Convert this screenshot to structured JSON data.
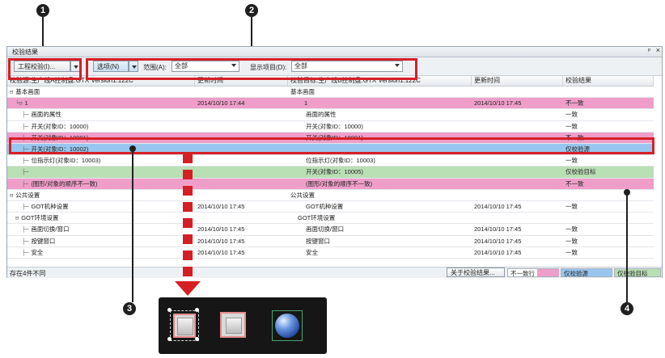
{
  "window": {
    "title": "校验结果",
    "pin_glyph": "ᵖ",
    "close_glyph": "×"
  },
  "toolbar": {
    "project_button": "工程校验(I)...",
    "options_button": "选项(N)",
    "range_label": "范围(A):",
    "range_value": "全部",
    "display_label": "显示项目(D):",
    "display_value": "全部"
  },
  "grid": {
    "columns": [
      "校验源:生产线A控制盘.GTX  Version1.122C",
      "更新时间",
      "校验目标:生产线B控制盘.GTX  Version1.122C",
      "更新时间",
      "校验结果"
    ],
    "rows": [
      {
        "type": "group",
        "src": "基本画面",
        "src_time": "",
        "tgt": "基本画面",
        "tgt_time": "",
        "result": "",
        "color": ""
      },
      {
        "type": "screen",
        "src": "1",
        "src_time": "2014/10/10 17:44",
        "tgt": "1",
        "tgt_time": "2014/10/10 17:45",
        "result": "不一致",
        "color": "pink"
      },
      {
        "type": "item",
        "src": "画面的属性",
        "src_time": "",
        "tgt": "画面的属性",
        "tgt_time": "",
        "result": "一致",
        "color": ""
      },
      {
        "type": "item",
        "src": "开关(对象ID：10000)",
        "src_time": "",
        "tgt": "开关(对象ID：10000)",
        "tgt_time": "",
        "result": "一致",
        "color": ""
      },
      {
        "type": "item",
        "src": "开关(对象ID：10001)",
        "src_time": "",
        "tgt": "开关(对象ID：10001)",
        "tgt_time": "",
        "result": "不一致",
        "color": "pink"
      },
      {
        "type": "item",
        "src": "开关(对象ID：10002)",
        "src_time": "",
        "tgt": "",
        "tgt_time": "",
        "result": "仅校验源",
        "color": "blue"
      },
      {
        "type": "item",
        "src": "位指示灯(对象ID：10003)",
        "src_time": "",
        "tgt": "位指示灯(对象ID：10003)",
        "tgt_time": "",
        "result": "一致",
        "color": ""
      },
      {
        "type": "item",
        "src": "",
        "src_time": "",
        "tgt": "开关(对象ID：10005)",
        "tgt_time": "",
        "result": "仅校验目标",
        "color": "green"
      },
      {
        "type": "item",
        "src": "(图形/对象的顺序不一致)",
        "src_time": "",
        "tgt": "(图形/对象的顺序不一致)",
        "tgt_time": "",
        "result": "不一致",
        "color": "pink"
      },
      {
        "type": "group",
        "src": "公共设置",
        "src_time": "",
        "tgt": "公共设置",
        "tgt_time": "",
        "result": "",
        "color": ""
      },
      {
        "type": "item",
        "src": "GOT机种设置",
        "src_time": "2014/10/10 17:45",
        "tgt": "GOT机种设置",
        "tgt_time": "2014/10/10 17:45",
        "result": "一致",
        "color": ""
      },
      {
        "type": "subgroup",
        "src": "GOT环境设置",
        "src_time": "",
        "tgt": "GOT环境设置",
        "tgt_time": "",
        "result": "",
        "color": ""
      },
      {
        "type": "item",
        "src": "画面切换/窗口",
        "src_time": "2014/10/10 17:45",
        "tgt": "画面切换/窗口",
        "tgt_time": "2014/10/10 17:45",
        "result": "一致",
        "color": ""
      },
      {
        "type": "item",
        "src": "按键窗口",
        "src_time": "2014/10/10 17:45",
        "tgt": "按键窗口",
        "tgt_time": "2014/10/10 17:45",
        "result": "一致",
        "color": ""
      },
      {
        "type": "item",
        "src": "安全",
        "src_time": "2014/10/10 17:45",
        "tgt": "安全",
        "tgt_time": "2014/10/10 17:45",
        "result": "一致",
        "color": ""
      }
    ]
  },
  "status": {
    "text": "存在4件不同",
    "about_button": "关于校验结果...",
    "legend": [
      {
        "label": "不一致行",
        "color": "#ef9ec9"
      },
      {
        "label": "仅校验源",
        "color": "#98c6ee"
      },
      {
        "label": "仅校验目标",
        "color": "#b9dfb4"
      }
    ]
  },
  "callouts": [
    "1",
    "2",
    "3",
    "4"
  ],
  "colors": {
    "annotation_red": "#d51f26",
    "mismatch_pink": "#ef9ec9",
    "source_only_blue": "#98c6ee",
    "target_only_green": "#b9dfb4"
  },
  "icons": [
    "switch-icon",
    "switch-icon",
    "lamp-icon"
  ]
}
